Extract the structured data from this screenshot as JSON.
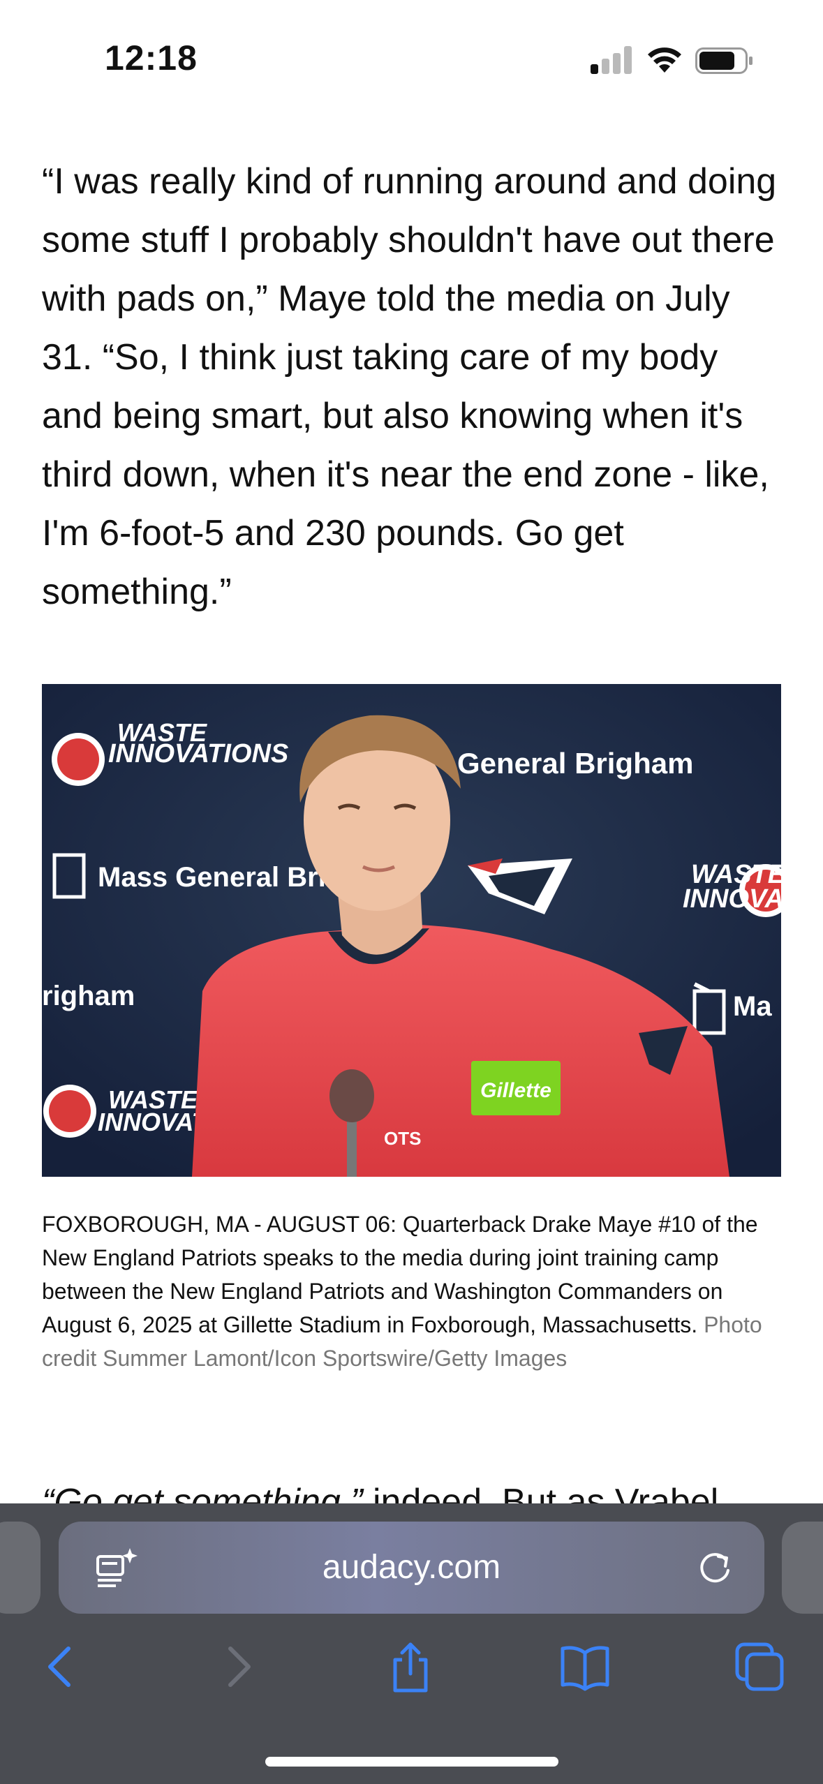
{
  "status": {
    "time": "12:18"
  },
  "article": {
    "paragraph": "“I was really kind of running around and doing some stuff I probably shouldn't have out there with pads on,” Maye told the media on July 31. “So, I think just taking care of my body and being smart, but also knowing when it's third down, when it's near the end zone - like, I'm 6-foot-5 and 230 pounds. Go get something.”",
    "image": {
      "sponsor_waste_1": "WASTE",
      "sponsor_waste_2": "INNOVATIONS",
      "sponsor_waste_short": "INNOVAT",
      "sponsor_brigham_1": "General Brigham",
      "sponsor_brigham_2": "Mass General Bri",
      "sponsor_brigham_3": "righam",
      "sponsor_brigham_4": "Ma",
      "jersey_sponsor": "Gillette",
      "mic_flag": "OTS"
    },
    "caption": "FOXBOROUGH, MA - AUGUST 06: Quarterback Drake Maye #10 of the New England Patriots speaks to the media during joint training camp between the New England Patriots and Washington Commanders on August 6, 2025 at Gillette Stadium in Foxborough, Massachusetts.",
    "credit": "Photo credit Summer Lamont/Icon Sportswire/Getty Images",
    "next_italic": "“Go get something,”",
    "next_rest": " indeed. But as Vrabel"
  },
  "browser": {
    "url": "audacy.com",
    "icons": {
      "reader": "reader-summary-icon",
      "reload": "reload-icon",
      "back": "back-chevron-icon",
      "forward": "forward-chevron-icon",
      "share": "share-icon",
      "bookmarks": "bookmarks-icon",
      "tabs": "tabs-icon"
    }
  },
  "colors": {
    "toolbar_blue": "#3b82f6",
    "jersey_red": "#e84a4f",
    "backdrop_navy": "#1d2a3f"
  }
}
